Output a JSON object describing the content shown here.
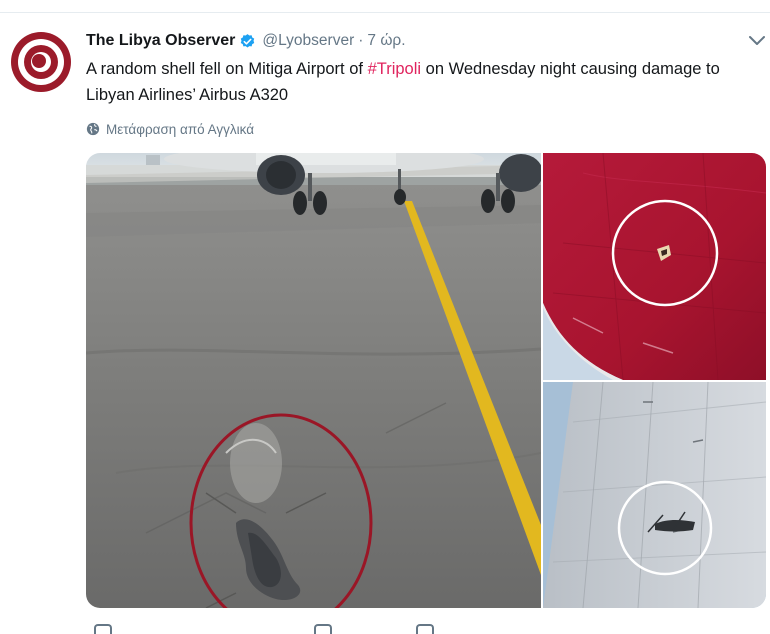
{
  "tweet": {
    "author_name": "The Libya Observer",
    "handle": "@Lyobserver",
    "separator": "·",
    "time": "7 ώρ.",
    "text_before": "A random shell fell on Mitiga Airport of ",
    "hashtag": "#Tripoli",
    "text_after": " on Wednesday night causing damage to Libyan Airlines’ Airbus A320",
    "translate_label": "Μετάφραση από Αγγλικά"
  },
  "icons": {
    "avatar": "libya-observer-logo",
    "verified": "verified-badge-icon",
    "menu": "chevron-down-icon",
    "translate": "globe-icon"
  },
  "colors": {
    "text": "#14171a",
    "secondary": "#657786",
    "hashtag": "#e0245e",
    "verified": "#1da1f2",
    "logo": "#9b1b2a"
  }
}
